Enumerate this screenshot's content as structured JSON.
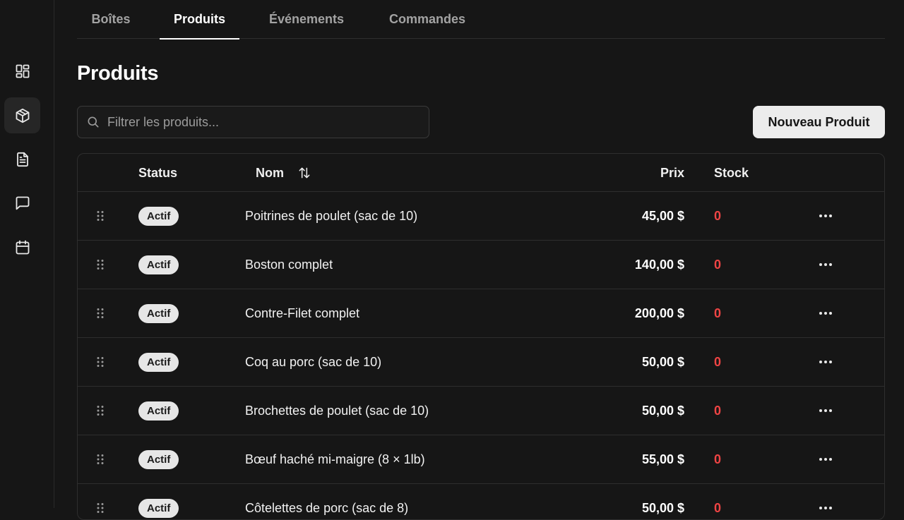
{
  "tabs": [
    {
      "label": "Boîtes"
    },
    {
      "label": "Produits",
      "active": true
    },
    {
      "label": "Événements"
    },
    {
      "label": "Commandes"
    }
  ],
  "page": {
    "title": "Produits"
  },
  "search": {
    "placeholder": "Filtrer les produits..."
  },
  "actions": {
    "new_product": "Nouveau Produit"
  },
  "table": {
    "headers": {
      "status": "Status",
      "name": "Nom",
      "price": "Prix",
      "stock": "Stock"
    },
    "rows": [
      {
        "status": "Actif",
        "name": "Poitrines de poulet (sac de 10)",
        "price": "45,00 $",
        "stock": "0"
      },
      {
        "status": "Actif",
        "name": "Boston complet",
        "price": "140,00 $",
        "stock": "0"
      },
      {
        "status": "Actif",
        "name": "Contre-Filet complet",
        "price": "200,00 $",
        "stock": "0"
      },
      {
        "status": "Actif",
        "name": "Coq au porc (sac de 10)",
        "price": "50,00 $",
        "stock": "0"
      },
      {
        "status": "Actif",
        "name": "Brochettes de poulet (sac de 10)",
        "price": "50,00 $",
        "stock": "0"
      },
      {
        "status": "Actif",
        "name": "Bœuf haché mi-maigre (8 × 1lb)",
        "price": "55,00 $",
        "stock": "0"
      },
      {
        "status": "Actif",
        "name": "Côtelettes de porc (sac de 8)",
        "price": "50,00 $",
        "stock": "0"
      }
    ]
  },
  "sidebar": {
    "icons": [
      "dashboard-icon",
      "package-icon",
      "document-icon",
      "message-icon",
      "calendar-icon"
    ],
    "active": "package-icon"
  },
  "colors": {
    "background": "#161616",
    "stock_zero": "#ef4444",
    "badge_bg": "#e6e6e6",
    "button_bg": "#ececec"
  }
}
